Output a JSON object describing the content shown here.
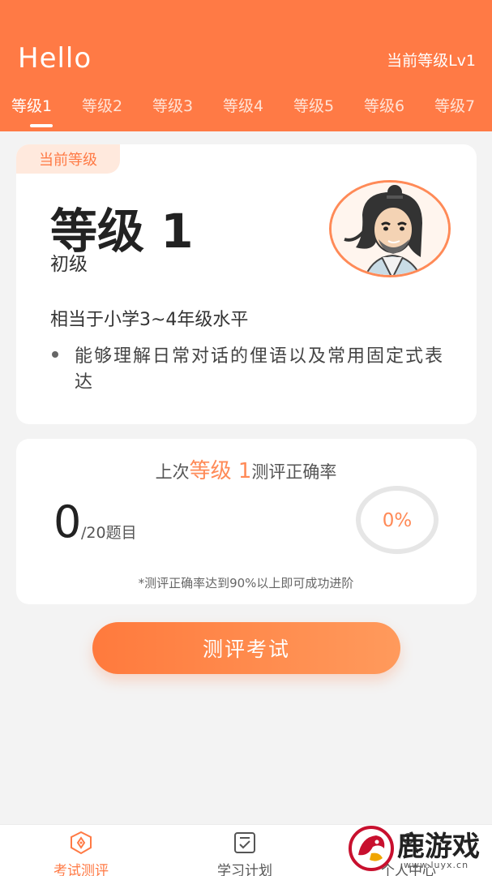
{
  "header": {
    "greeting": "Hello",
    "current_level": "当前等级Lv1",
    "tabs": [
      "等级1",
      "等级2",
      "等级3",
      "等级4",
      "等级5",
      "等级6",
      "等级7"
    ],
    "active_tab_index": 0
  },
  "level_card": {
    "badge": "当前等级",
    "title": "等级 1",
    "subtitle": "初级",
    "equivalent": "相当于小学3~4年级水平",
    "bullet": "能够理解日常对话的俚语以及常用固定式表达"
  },
  "result_card": {
    "prefix": "上次",
    "level_highlight": "等级 1",
    "suffix": "测评正确率",
    "score": "0",
    "total": "/20题目",
    "accuracy": "0%",
    "accuracy_value": 0,
    "note": "*测评正确率达到90%以上即可成功进阶"
  },
  "actions": {
    "exam_button": "测评考试"
  },
  "tabbar": {
    "items": [
      {
        "label": "考试测评",
        "icon": "exam-icon",
        "active": true
      },
      {
        "label": "学习计划",
        "icon": "plan-icon",
        "active": false
      },
      {
        "label": "个人中心",
        "icon": "profile-icon",
        "active": false
      }
    ]
  },
  "watermark": {
    "text": "鹿游戏",
    "url": "www.luyx.cn"
  },
  "colors": {
    "accent": "#ff7a45",
    "badge_bg": "#ffe9dd",
    "background": "#f3f3f3"
  }
}
